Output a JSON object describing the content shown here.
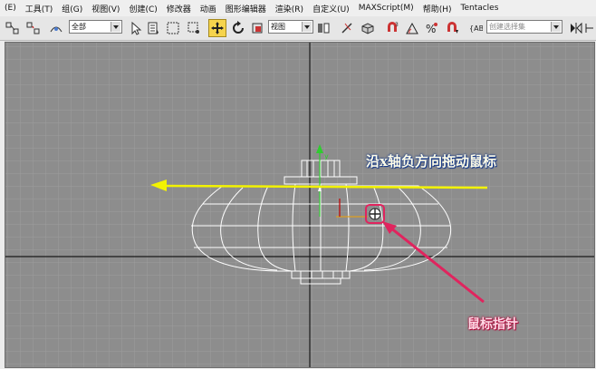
{
  "menu": [
    "(E)",
    "工具(T)",
    "组(G)",
    "视图(V)",
    "创建(C)",
    "修改器",
    "动画",
    "图形编辑器",
    "渲染(R)",
    "自定义(U)",
    "MAXScript(M)",
    "帮助(H)",
    "Tentacles"
  ],
  "toolbar": {
    "filter_value": "全部",
    "view_value": "视图",
    "selection_set_placeholder": "创建选择集"
  },
  "annotations": {
    "drag_instruction": "沿x轴负方向拖动鼠标",
    "cursor_label": "鼠标指针"
  },
  "colors": {
    "viewport_bg": "#8d8d8d",
    "grid_line": "#9c9c9c",
    "axis_line": "#1a1a1a",
    "wireframe": "#ffffff",
    "arrow_yellow": "#f2f200",
    "callout_pink": "#e0245e",
    "active_tool": "#f6d44c"
  },
  "icons": [
    "select-link-icon",
    "unlink-icon",
    "select-object-icon",
    "select-by-name-icon",
    "rect-region-icon",
    "window-crossing-icon",
    "move-icon",
    "rotate-icon",
    "scale-icon",
    "pivot-icon",
    "snap-icon",
    "angle-snap-icon",
    "percent-snap-icon",
    "spinner-snap-icon",
    "named-selection-icon",
    "mirror-icon"
  ]
}
